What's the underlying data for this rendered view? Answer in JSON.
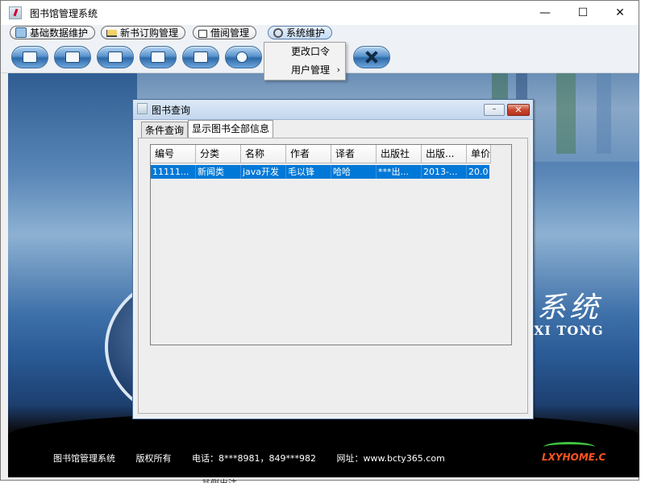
{
  "window": {
    "title": "图书馆管理系统",
    "controls": {
      "minimize": "—",
      "maximize": "☐",
      "close": "✕"
    }
  },
  "menubar": {
    "items": [
      {
        "label": "基础数据维护",
        "icon": "cube-icon"
      },
      {
        "label": "新书订购管理",
        "icon": "cart-icon"
      },
      {
        "label": "借阅管理",
        "icon": "lock-icon"
      },
      {
        "label": "系统维护",
        "icon": "gear-icon",
        "active": true
      }
    ]
  },
  "dropdown": {
    "items": [
      {
        "label": "更改口令"
      },
      {
        "label": "用户管理",
        "submenu_arrow": "›"
      }
    ]
  },
  "toolbar": {
    "buttons": [
      "book-icon",
      "pen-icon",
      "books-icon",
      "reader-icon",
      "stack-icon",
      "magnifier-icon",
      "wrench-icon"
    ]
  },
  "background": {
    "brand_cn": "系统",
    "brand_en": "XI TONG",
    "footer": [
      "图书馆管理系统",
      "版权所有",
      "电话：8***8981，849***982",
      "网址：www.bcty365.com"
    ],
    "logo": "LXYHOME.C"
  },
  "below_text": "其侧出注。",
  "internal_frame": {
    "title": "图书查询",
    "controls": {
      "minimize": "–",
      "close": "✕"
    },
    "tabs": [
      {
        "label": "条件查询",
        "selected": false
      },
      {
        "label": "显示图书全部信息",
        "selected": true
      }
    ],
    "table": {
      "columns": [
        "编号",
        "分类",
        "名称",
        "作者",
        "译者",
        "出版社",
        "出版...",
        "单价"
      ],
      "rows": [
        [
          "11111...",
          "新闻类",
          "java开发",
          "毛以锋",
          "哈哈",
          "***出...",
          "2013-...",
          "20.0"
        ]
      ],
      "selected_row": 0
    }
  },
  "colors": {
    "selection": "#0078d7",
    "frame_border": "#4a6d96",
    "close_button": "#c9462d"
  }
}
